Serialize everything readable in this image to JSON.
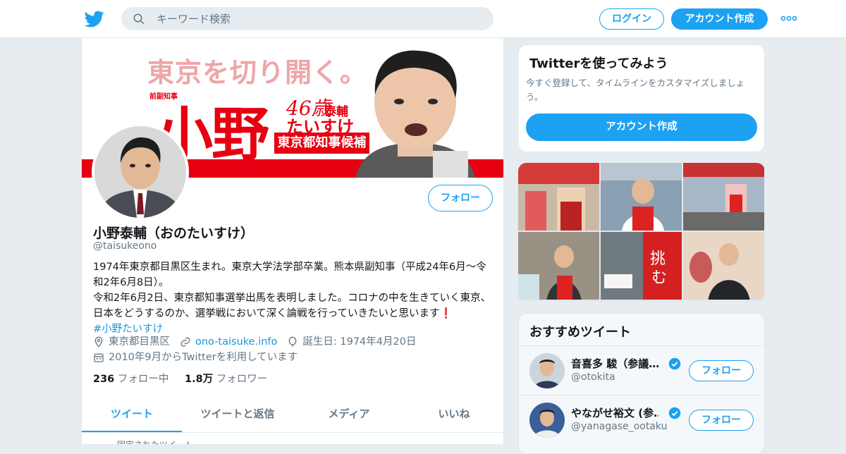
{
  "header": {
    "search_placeholder": "キーワード検索",
    "login_label": "ログイン",
    "signup_label": "アカウント作成"
  },
  "banner": {
    "slogan": "東京を切り開く。",
    "sub_title": "前副知事",
    "surname": "小野",
    "age": "46歳",
    "given_name": "泰輔",
    "kana": "たいすけ",
    "office": "東京都知事候補"
  },
  "profile": {
    "follow_label": "フォロー",
    "name": "小野泰輔（おのたいすけ）",
    "handle": "@taisukeono",
    "bio_line1": "1974年東京都目黒区生まれ。東京大学法学部卒業。熊本県副知事（平成24年6月～令和2年6月8日）。",
    "bio_line2": "令和2年6月2日、東京都知事選挙出馬を表明しました。コロナの中を生きていく東京、日本をどうするのか、選挙戦において深く論戦を行っていきたいと思います",
    "bio_emoji": "❗",
    "hashtag": "#小野たいすけ",
    "location": "東京都目黒区",
    "website": "ono-taisuke.info",
    "birthday": "誕生日: 1974年4月20日",
    "joined": "2010年9月からTwitterを利用しています",
    "following_count": "236",
    "following_label": "フォロー中",
    "followers_count": "1.8万",
    "followers_label": "フォロワー"
  },
  "tabs": [
    "ツイート",
    "ツイートと返信",
    "メディア",
    "いいね"
  ],
  "pinned_label": "固定されたツイート",
  "try_card": {
    "title": "Twitterを使ってみよう",
    "description": "今すぐ登録して、タイムラインをカスタマイズしましょう。",
    "button": "アカウント作成"
  },
  "recommended": {
    "title": "おすすめツイート",
    "users": [
      {
        "name": "音喜多 駿（参議…",
        "handle": "@otokita",
        "follow": "フォロー"
      },
      {
        "name": "やながせ裕文 (参…",
        "handle": "@yanagase_ootaku",
        "follow": "フォロー"
      }
    ]
  },
  "colors": {
    "accent": "#1da1f2",
    "banner_red": "#e60012",
    "muted": "#657786"
  }
}
